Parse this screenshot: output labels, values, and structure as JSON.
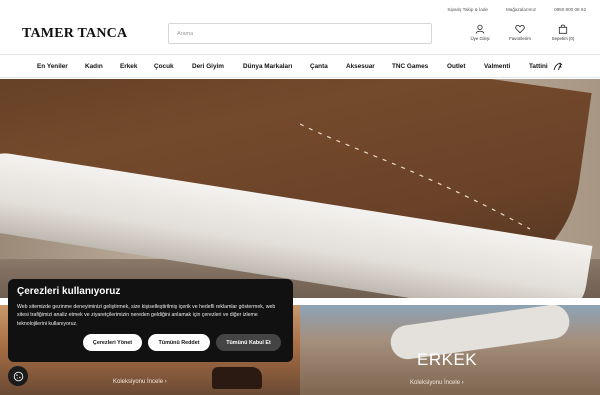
{
  "topbar": {
    "order_tracking": "Sipariş Takip & İade",
    "stores": "Mağazalarımız",
    "phone": "0850 800 08 62"
  },
  "header": {
    "logo": "TAMER TANCA",
    "search_placeholder": "Arama",
    "account_label": "Üye Girişi",
    "favorites_label": "Favorilerim",
    "cart_label": "Sepetim (0)"
  },
  "nav": {
    "items": [
      "En Yeniler",
      "Kadın",
      "Erkek",
      "Çocuk",
      "Deri Giyim",
      "Dünya Markaları",
      "Çanta",
      "Aksesuar",
      "TNC Games",
      "Outlet",
      "Valmenti",
      "Tattini"
    ]
  },
  "collections": {
    "women_link": "Koleksiyonu İncele ›",
    "men_title": "ERKEK",
    "men_link": "Koleksiyonu İncele ›"
  },
  "cookie_banner": {
    "title": "Çerezleri kullanıyoruz",
    "body": "Web sitemizde gezinme deneyiminizi geliştirmek, size kişiselleştirilmiş içerik ve hedefli reklamlar göstermek, web sitesi trafiğimizi analiz etmek ve ziyaretçilerimizin nereden geldiğini anlamak için çerezleri ve diğer izleme teknolojilerini kullanıyoruz.",
    "manage_label": "Çerezleri Yönet",
    "reject_label": "Tümünü Reddet",
    "accept_label": "Tümünü Kabul Et"
  },
  "colors": {
    "banner_bg": "#111111",
    "accept_bg": "#444444"
  }
}
